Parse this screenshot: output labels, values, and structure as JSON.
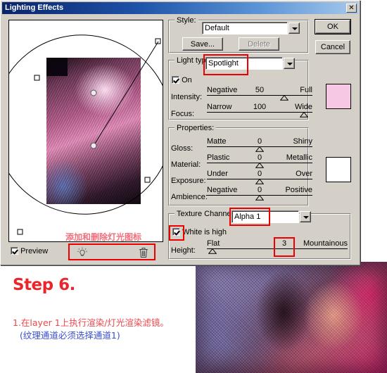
{
  "window": {
    "title": "Lighting Effects",
    "close_label": "✕"
  },
  "preview": {
    "checkbox_label": "Preview",
    "checked": true,
    "bulb_icon": "light-bulb-icon",
    "trash_icon": "trash-icon",
    "annotation_cn": "添加和删除灯光图标"
  },
  "style_group": {
    "label": "Style:",
    "value": "Default",
    "save_label": "Save...",
    "delete_label": "Delete",
    "delete_disabled": true
  },
  "actions": {
    "ok_label": "OK",
    "cancel_label": "Cancel"
  },
  "light_type_group": {
    "label": "Light type:",
    "value": "Spotlight",
    "on_label": "On",
    "on_checked": true,
    "swatch_color": "#f7c8e4",
    "sliders": [
      {
        "name": "Intensity:",
        "left": "Negative",
        "right": "Full",
        "value": "50",
        "pos": 73
      },
      {
        "name": "Focus:",
        "left": "Narrow",
        "right": "Wide",
        "value": "100",
        "pos": 92
      }
    ]
  },
  "properties_group": {
    "label": "Properties:",
    "swatch_color": "#ffffff",
    "sliders": [
      {
        "name": "Gloss:",
        "left": "Matte",
        "right": "Shiny",
        "value": "0",
        "pos": 50
      },
      {
        "name": "Material:",
        "left": "Plastic",
        "right": "Metallic",
        "value": "0",
        "pos": 50
      },
      {
        "name": "Exposure:",
        "left": "Under",
        "right": "Over",
        "value": "0",
        "pos": 50
      },
      {
        "name": "Ambience:",
        "left": "Negative",
        "right": "Positive",
        "value": "0",
        "pos": 50
      }
    ]
  },
  "texture_group": {
    "label": "Texture Channel:",
    "value": "Alpha 1",
    "white_is_high_label": "White is high",
    "white_is_high_checked": true,
    "height_slider": {
      "name": "Height:",
      "left": "Flat",
      "right": "Mountainous",
      "value": "3",
      "pos": 4
    }
  },
  "tutorial": {
    "step_title": "Step 6.",
    "line1": "1.在layer 1上执行渲染/灯光渲染滤镜。",
    "line2": "(纹理通道必须选择通道1)"
  },
  "colors": {
    "annotation_red": "#ee0000",
    "title_red": "#e8262b",
    "text_red": "#e8484d",
    "text_blue": "#3a4fd0",
    "dialog_face": "#d4d0c8"
  }
}
